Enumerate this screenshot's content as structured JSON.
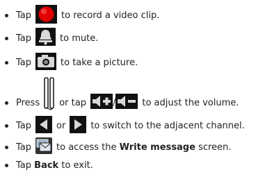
{
  "items": [
    {
      "pre": "Tap",
      "icon": "record-icon",
      "post": "to record a video clip."
    },
    {
      "pre": "Tap",
      "icon": "mute-bell-icon",
      "post": "to mute."
    },
    {
      "pre": "Tap",
      "icon": "camera-icon",
      "post": "to take a picture."
    },
    {
      "pre": "Press",
      "icon": "volume-side-keys-icon",
      "mid": "or tap",
      "icon2": "volume-up-icon",
      "sep": "/",
      "icon3": "volume-down-icon",
      "post": "to adjust the volume."
    },
    {
      "pre": "Tap",
      "icon": "previous-channel-icon",
      "mid": "or",
      "icon2": "next-channel-icon",
      "post": "to switch to the adjacent channel."
    },
    {
      "pre": "Tap",
      "icon": "message-icon",
      "post": "to access the",
      "bold": "Write message",
      "post2": "screen."
    },
    {
      "pre": "Tap",
      "bold": "Back",
      "post": "to exit."
    }
  ],
  "colors": {
    "record": "#e00000",
    "icon_dark": "#1a1a1a",
    "icon_grey": "#555555"
  }
}
